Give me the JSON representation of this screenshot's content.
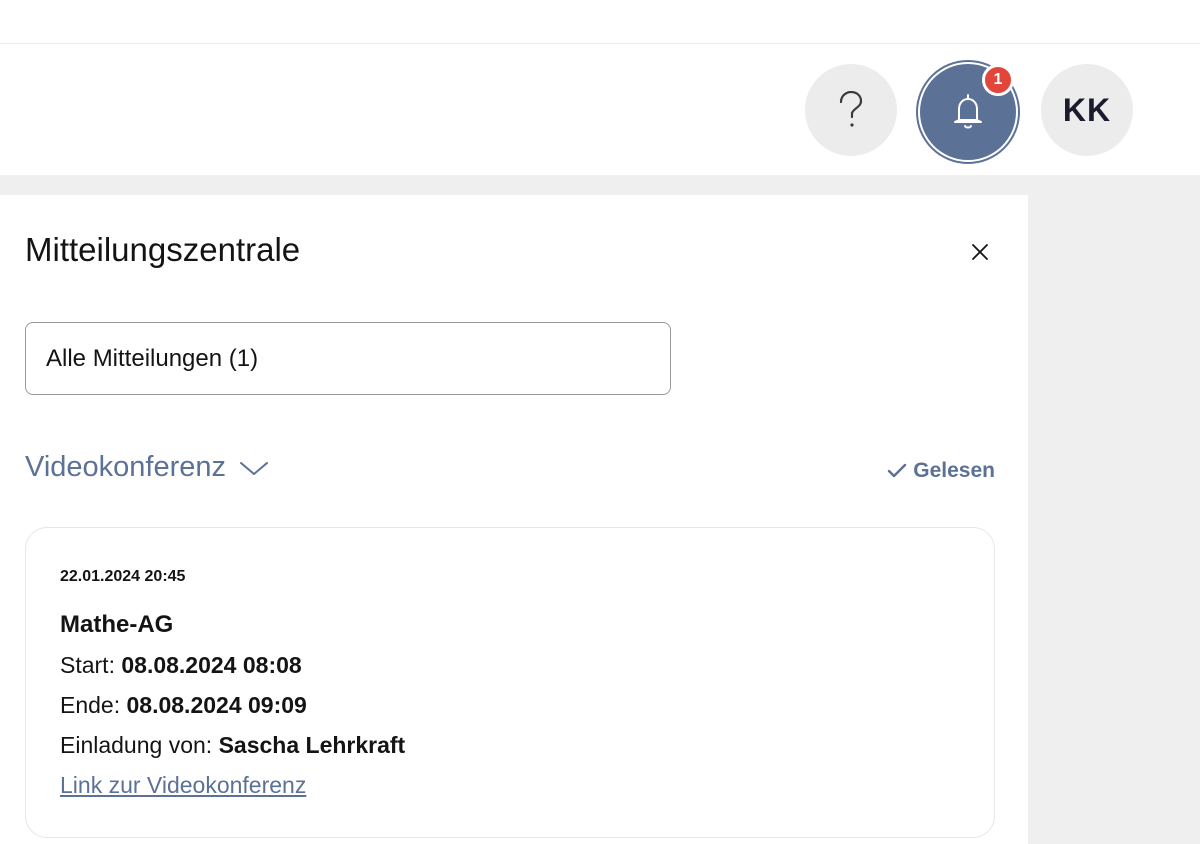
{
  "header": {
    "help_glyph": "question-mark-icon",
    "notifications_icon": "bell-icon",
    "notification_count": "1",
    "avatar_initials": "KK"
  },
  "panel": {
    "title": "Mitteilungszentrale",
    "close_icon": "close-icon",
    "filter": {
      "selected": "Alle Mitteilungen (1)"
    },
    "category": {
      "label": "Videokonferenz",
      "icon": "chevron-down-icon"
    },
    "mark_read": {
      "label": "Gelesen",
      "icon": "check-icon"
    },
    "notification": {
      "timestamp": "22.01.2024 20:45",
      "title": "Mathe-AG",
      "start_label": "Start:",
      "start_value": "08.08.2024 08:08",
      "end_label": "Ende:",
      "end_value": "08.08.2024 09:09",
      "invite_label": "Einladung von:",
      "invite_value": "Sascha Lehrkraft",
      "link_text": "Link zur Videokonferenz"
    }
  },
  "colors": {
    "accent": "#5c7196",
    "badge": "#e2453a",
    "backdrop": "#efefef",
    "circle_button": "#ececec"
  }
}
